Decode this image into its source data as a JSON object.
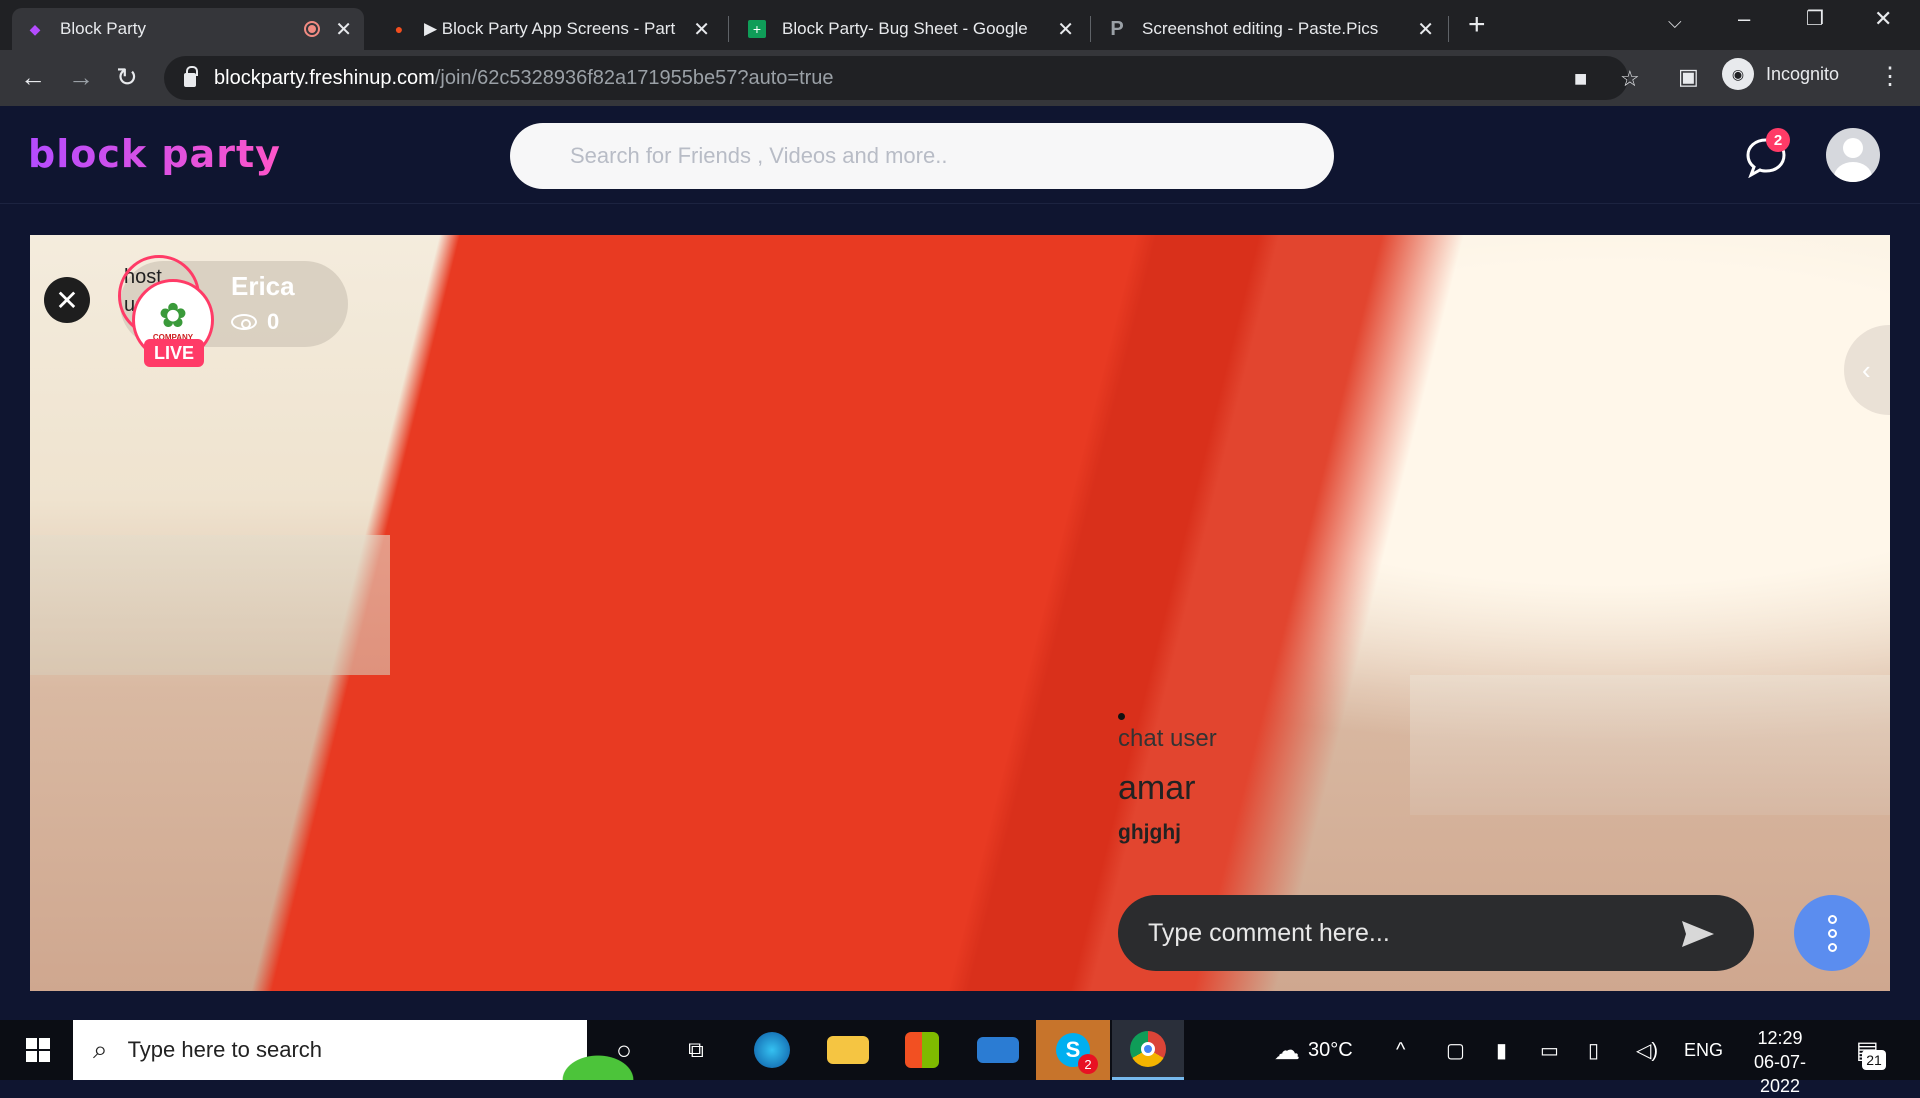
{
  "browser": {
    "tabs": [
      {
        "title": "Block Party",
        "icon": "block-party-favicon"
      },
      {
        "title": "▶ Block Party App Screens - Part",
        "icon": "figma-icon"
      },
      {
        "title": "Block Party- Bug Sheet - Google",
        "icon": "sheets-icon"
      },
      {
        "title": "Screenshot editing - Paste.Pics",
        "icon": "pastepics-icon"
      }
    ],
    "url_host": "blockparty.freshinup.com",
    "url_path": "/join/62c5328936f82a171955be57?auto=true",
    "profile_label": "Incognito"
  },
  "app": {
    "logo": "block party",
    "search_placeholder": "Search for Friends , Videos and more..",
    "chat_badge": "2"
  },
  "stream": {
    "host_image_alt": "host user",
    "host_name": "Erica",
    "live_label": "LIVE",
    "viewers": "0",
    "company_text": "COMPANY",
    "chat": {
      "image_alt": "chat user",
      "user_name": "amar",
      "message": "ghjghj"
    },
    "comment_placeholder": "Type comment here..."
  },
  "taskbar": {
    "search_placeholder": "Type here to search",
    "skype_badge": "2",
    "weather": "30°C",
    "language": "ENG",
    "time": "12:29",
    "date": "06-07-2022",
    "notifications": "21"
  }
}
